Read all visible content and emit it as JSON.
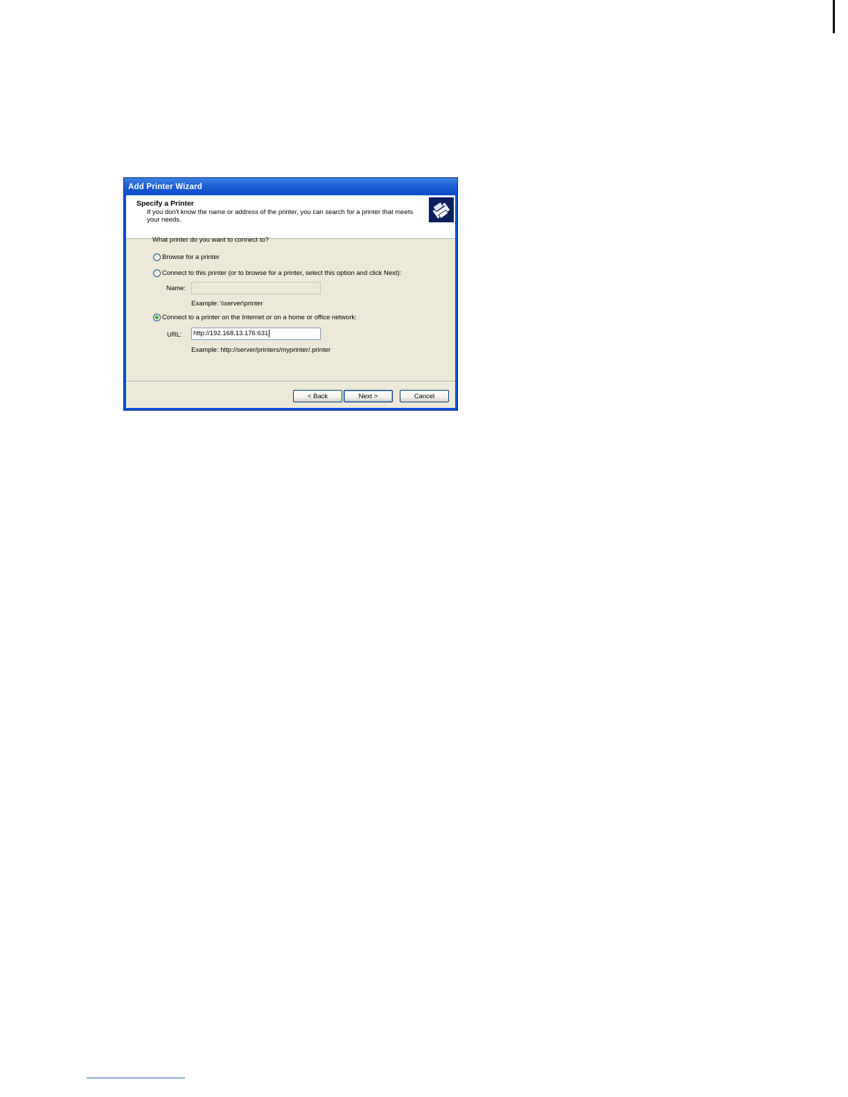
{
  "dialog": {
    "title": "Add Printer Wizard",
    "header_title": "Specify a Printer",
    "header_subtitle": "If you don't know the name or address of the printer, you can search for a printer that meets your needs.",
    "header_icon": "printer-icon",
    "question": "What printer do you want to connect to?",
    "options": [
      {
        "label": "Browse for a printer",
        "checked": false
      },
      {
        "label": "Connect to this printer (or to browse for a printer, select this option and click Next):",
        "checked": false
      },
      {
        "label": "Connect to a printer on the Internet or on a home or office network:",
        "checked": true
      }
    ],
    "name_field": {
      "label": "Name:",
      "value": "",
      "example": "Example: \\\\server\\printer"
    },
    "url_field": {
      "label": "URL:",
      "value": "http://192.168.13.176:631",
      "example": "Example: http://server/printers/myprinter/.printer"
    },
    "buttons": {
      "back": "< Back",
      "next": "Next >",
      "cancel": "Cancel"
    }
  },
  "colors": {
    "titlebar": "#0a4dc7",
    "dialog_bg": "#ece9d8",
    "radio_checked": "#31a735"
  }
}
